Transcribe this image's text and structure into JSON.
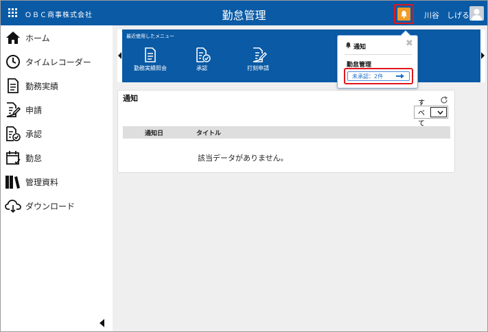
{
  "header": {
    "company": "ＯＢＣ商事株式会社",
    "title": "勤怠管理",
    "user_name": "川谷　しげる"
  },
  "sidebar": {
    "items": [
      {
        "label": "ホーム",
        "icon": "home-icon"
      },
      {
        "label": "タイムレコーダー",
        "icon": "clock-icon"
      },
      {
        "label": "勤務実績",
        "icon": "document-icon"
      },
      {
        "label": "申請",
        "icon": "edit-document-icon"
      },
      {
        "label": "承認",
        "icon": "check-document-icon"
      },
      {
        "label": "勤怠",
        "icon": "calendar-icon"
      },
      {
        "label": "管理資料",
        "icon": "books-icon"
      },
      {
        "label": "ダウンロード",
        "icon": "cloud-download-icon"
      }
    ]
  },
  "recent_menu": {
    "title": "最近使用したメニュー",
    "items": [
      {
        "label": "勤務実績照会",
        "icon": "document-icon"
      },
      {
        "label": "承認",
        "icon": "check-document-icon"
      },
      {
        "label": "打刻申請",
        "icon": "edit-document-icon"
      }
    ]
  },
  "notice_card": {
    "title": "通知",
    "filter_value": "すべて",
    "columns": [
      "通知日",
      "タイトル"
    ],
    "empty_message": "該当データがありません。"
  },
  "popover": {
    "title": "通知",
    "section": "勤怠管理",
    "link_label": "未承認：2件"
  },
  "colors": {
    "brand_blue": "#0a5aa5",
    "bell_orange": "#f39a25",
    "highlight_red": "#e0161d",
    "link_blue": "#1a6fc6"
  }
}
